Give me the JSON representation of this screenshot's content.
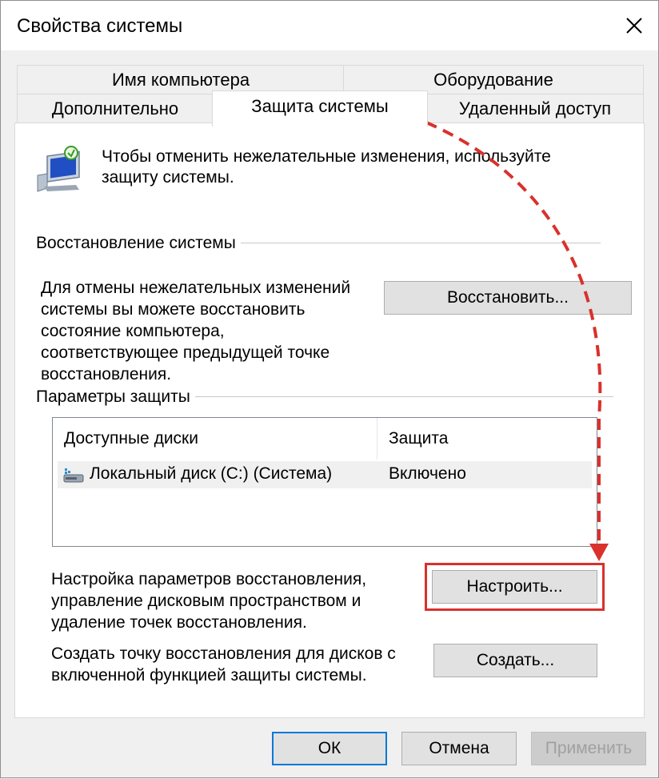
{
  "window": {
    "title": "Свойства системы",
    "close_icon": "close-icon"
  },
  "tabs": {
    "row1": [
      {
        "label": "Имя компьютера"
      },
      {
        "label": "Оборудование"
      }
    ],
    "row2": [
      {
        "label": "Дополнительно"
      },
      {
        "label": "Защита системы",
        "active": true
      },
      {
        "label": "Удаленный доступ"
      }
    ]
  },
  "intro": {
    "icon": "system-protection-icon",
    "line1": "Чтобы отменить нежелательные изменения, используйте",
    "line2": "защиту системы."
  },
  "restore_group": {
    "label": "Восстановление системы",
    "desc_lines": [
      "Для отмены нежелательных изменений",
      "системы вы можете восстановить",
      "состояние компьютера,",
      "соответствующее предыдущей точке",
      "восстановления."
    ],
    "button_label": "Восстановить..."
  },
  "protection_group": {
    "label": "Параметры защиты",
    "columns": [
      "Доступные диски",
      "Защита"
    ],
    "rows": [
      {
        "icon": "drive-icon",
        "disk": "Локальный диск (C:) (Система)",
        "protection": "Включено"
      }
    ],
    "configure_desc": [
      "Настройка параметров восстановления,",
      "управление дисковым пространством и",
      "удаление точек восстановления."
    ],
    "configure_button": "Настроить...",
    "create_desc": [
      "Создать точку восстановления для дисков с",
      "включенной функцией защиты системы."
    ],
    "create_button": "Создать..."
  },
  "footer": {
    "ok": "ОК",
    "cancel": "Отмена",
    "apply": "Применить"
  },
  "colors": {
    "highlight": "#d9312c",
    "accent": "#0078d7"
  }
}
